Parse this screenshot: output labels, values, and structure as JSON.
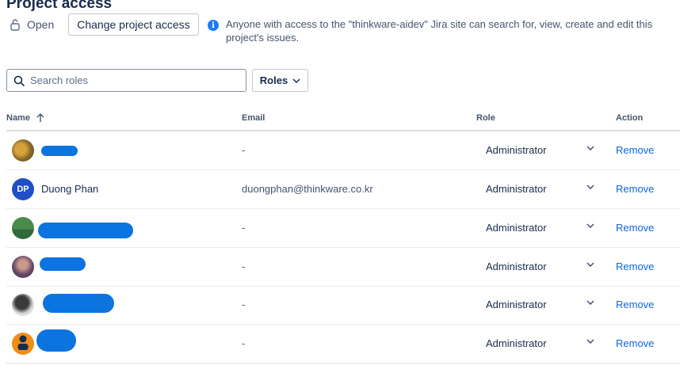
{
  "header": {
    "title": "Project access",
    "access_status": "Open",
    "change_button": "Change project access",
    "info_text": "Anyone with access to the \"thinkware-aidev\" Jira site can search for, view, create and edit this project's issues."
  },
  "filters": {
    "search_placeholder": "Search roles",
    "search_value": "",
    "roles_label": "Roles"
  },
  "table": {
    "columns": {
      "name": "Name",
      "email": "Email",
      "role": "Role",
      "action": "Action"
    },
    "rows": [
      {
        "name": "",
        "avatar": "photo-icon",
        "email": "-",
        "role": "Administrator",
        "action": "Remove"
      },
      {
        "name": "Duong Phan",
        "avatar_initials": "DP",
        "email": "duongphan@thinkware.co.kr",
        "role": "Administrator",
        "action": "Remove"
      },
      {
        "name": "",
        "avatar": "photo-icon",
        "email": "-",
        "role": "Administrator",
        "action": "Remove"
      },
      {
        "name": "",
        "avatar": "photo-icon",
        "email": "-",
        "role": "Administrator",
        "action": "Remove"
      },
      {
        "name": "",
        "avatar": "photo-icon",
        "email": "-",
        "role": "Administrator",
        "action": "Remove"
      },
      {
        "name": "",
        "avatar": "default-user-icon",
        "email": "-",
        "role": "Administrator",
        "action": "Remove"
      }
    ]
  },
  "colors": {
    "link": "#0c66e4",
    "info": "#1d7afc",
    "redaction": "#0b74de",
    "avatar_dp": "#1f4ec6"
  }
}
